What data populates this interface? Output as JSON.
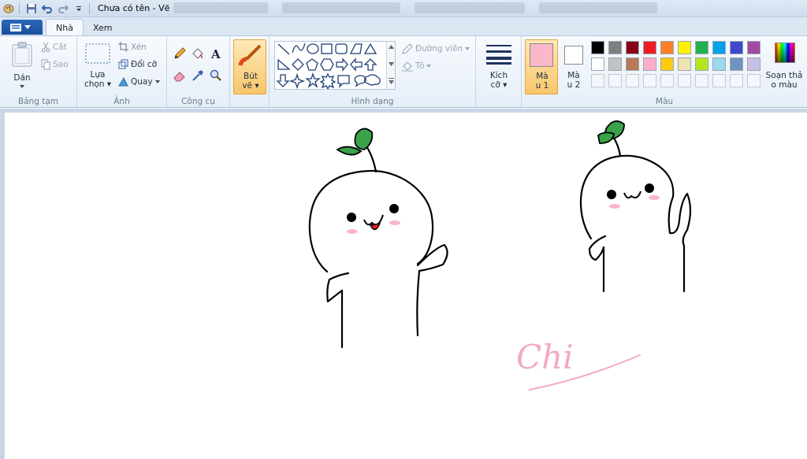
{
  "window": {
    "title": "Chưa có tên - Vẽ"
  },
  "tabs": {
    "file_label": "",
    "home": "Nhà",
    "view": "Xem"
  },
  "clipboard": {
    "paste": "Dán",
    "cut": "Cắt",
    "copy": "Sao",
    "group": "Bảng tạm"
  },
  "image": {
    "select_line1": "Lựa",
    "select_line2": "chọn",
    "crop": "Xén",
    "resize": "Đổi cỡ",
    "rotate": "Quay",
    "group": "Ảnh"
  },
  "tools": {
    "group": "Công cụ"
  },
  "brushes": {
    "line1": "Bút",
    "line2": "vẽ"
  },
  "shapes": {
    "outline": "Đường viền",
    "fill": "Tô",
    "group": "Hình dạng"
  },
  "size": {
    "line1": "Kích",
    "line2": "cỡ"
  },
  "colors": {
    "color1_line1": "Mà",
    "color1_line2": "u 1",
    "color2_line1": "Mà",
    "color2_line2": "u 2",
    "edit_line1": "Soạn thả",
    "edit_line2": "o màu",
    "group": "Màu",
    "color1_value": "#f9b7c8",
    "color2_value": "#ffffff",
    "palette_row1": [
      "#000000",
      "#7f7f7f",
      "#880015",
      "#ed1c24",
      "#ff7f27",
      "#fff200",
      "#22b14c",
      "#00a2e8",
      "#3f48cc",
      "#a349a4"
    ],
    "palette_row2": [
      "#ffffff",
      "#c3c3c3",
      "#b97a57",
      "#ffaec9",
      "#ffc90e",
      "#efe4b0",
      "#b5e61d",
      "#99d9ea",
      "#7092be",
      "#c8bfe7"
    ]
  },
  "canvas_text": {
    "signature": "Chi"
  }
}
